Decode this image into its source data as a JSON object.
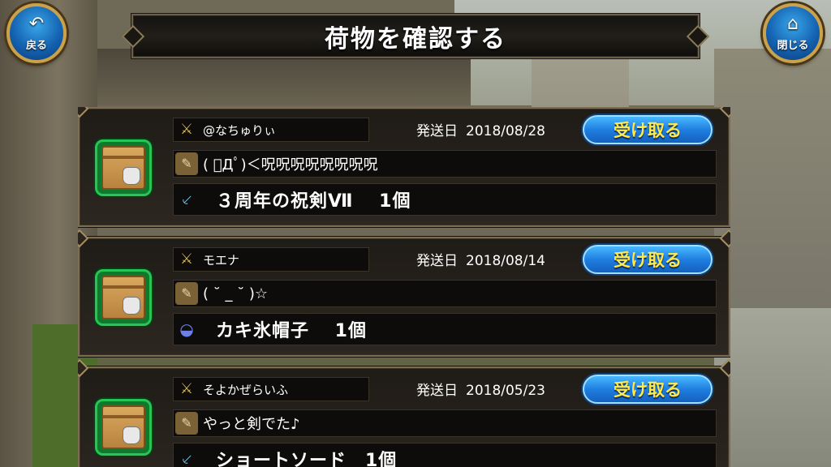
{
  "header": {
    "title": "荷物を確認する",
    "back_label": "戻る",
    "close_label": "閉じる",
    "back_icon": "↶",
    "close_icon": "⌂"
  },
  "date_label": "発送日",
  "receive_label": "受け取る",
  "parcels": [
    {
      "sender": "@なちゅりぃ",
      "date": "2018/08/28",
      "message": "( ﾟДﾟ)＜呪呪呪呪呪呪呪呪",
      "item": "３周年の祝剣Ⅶ　 1個",
      "item_icon": "⸔"
    },
    {
      "sender": "モエナ",
      "date": "2018/08/14",
      "message": "( ˘ _ ˘ )☆",
      "item": "カキ氷帽子　 1個",
      "item_icon": "◒"
    },
    {
      "sender": "そよかぜらいふ",
      "date": "2018/05/23",
      "message": "やっと剣でた♪",
      "item": "ショートソード　1個",
      "item_icon": "⸔"
    }
  ],
  "colors": {
    "receive_text": "#ffe94a",
    "receive_button": "#1f7fe0",
    "box_border": "#29c456"
  }
}
